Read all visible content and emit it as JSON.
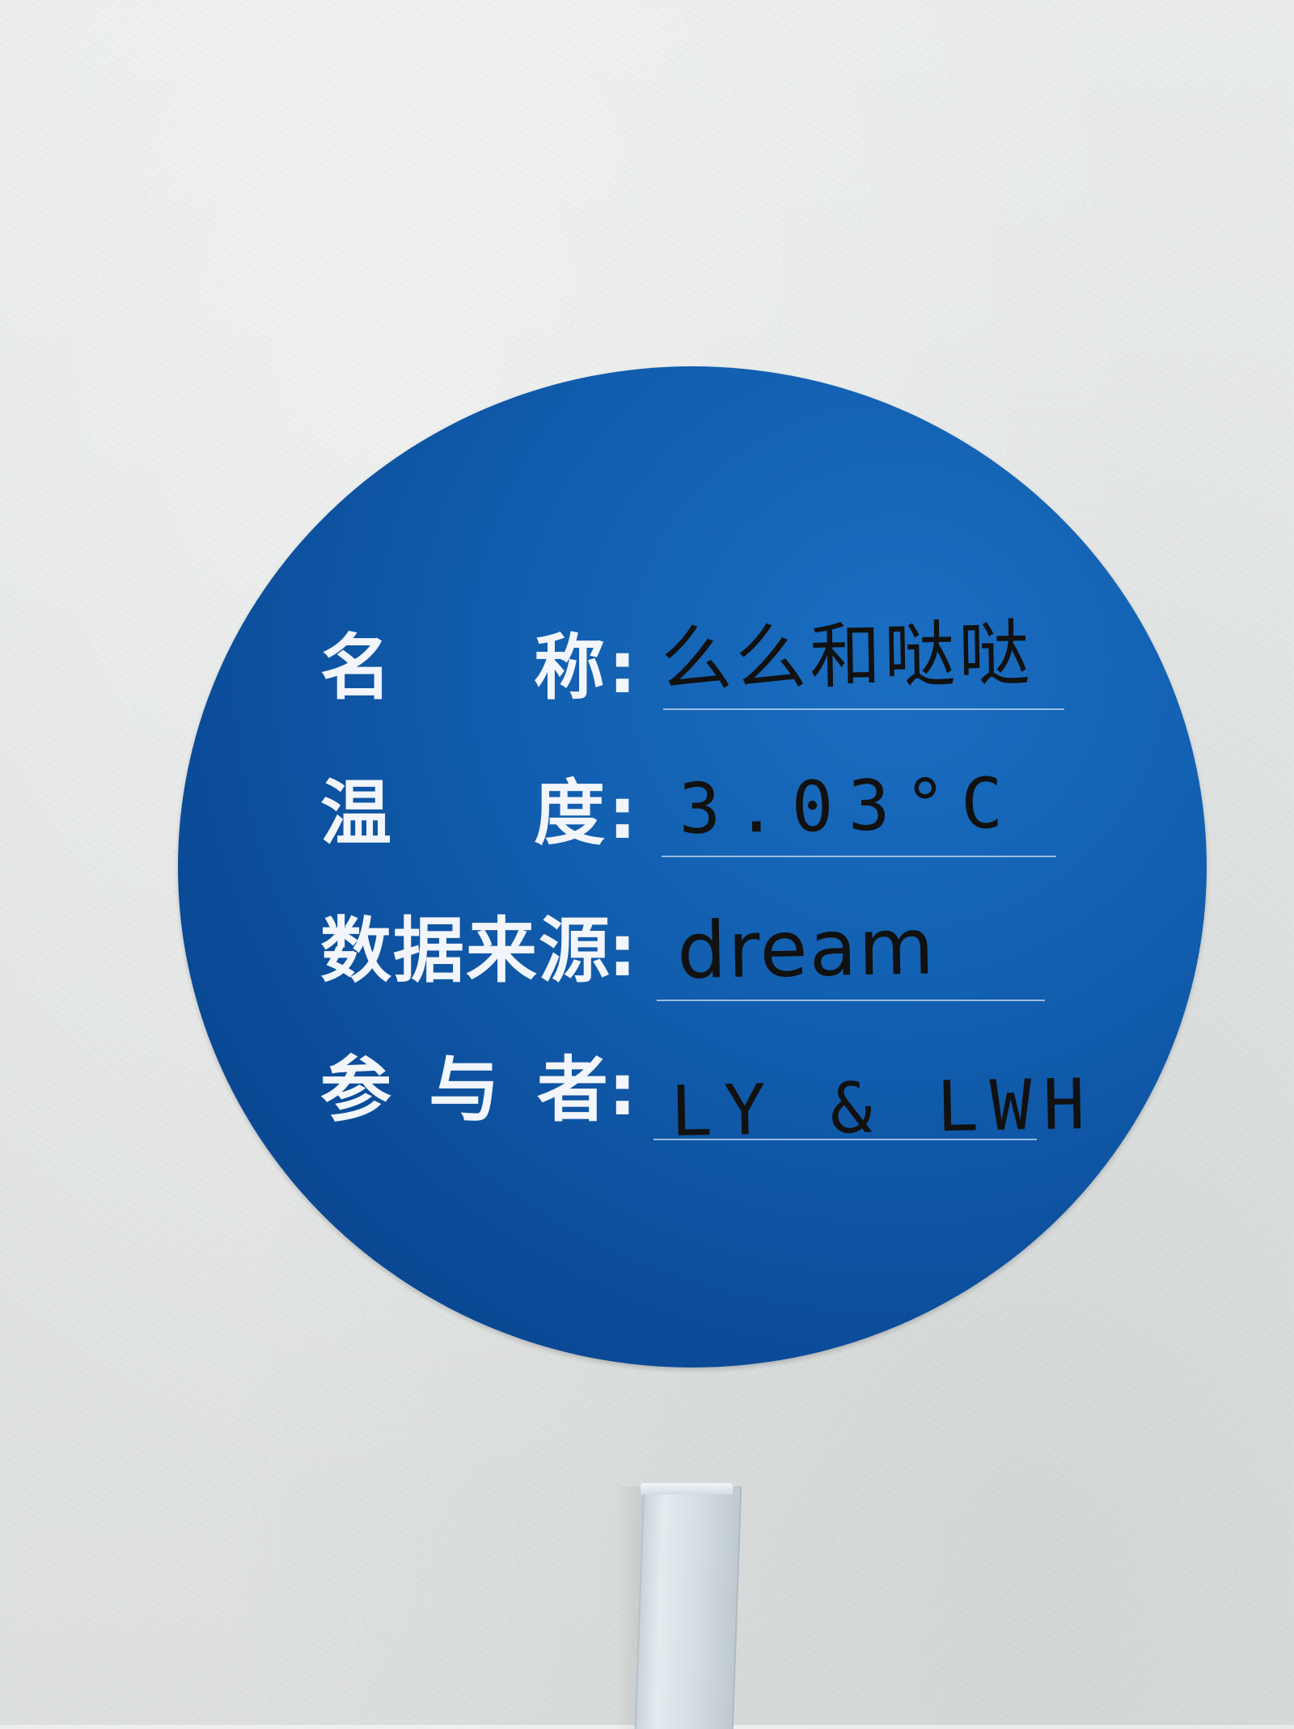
{
  "sticker": {
    "color": "#125fb0",
    "rows": [
      {
        "label": "名 称",
        "colon": ":",
        "value": "么么和哒哒"
      },
      {
        "label": "温 度",
        "colon": ":",
        "value": "3.03°C"
      },
      {
        "label": "数据来源",
        "colon": ":",
        "value": "dream"
      },
      {
        "label": "参 与 者",
        "colon": ":",
        "value": "LY & LWH"
      }
    ]
  }
}
